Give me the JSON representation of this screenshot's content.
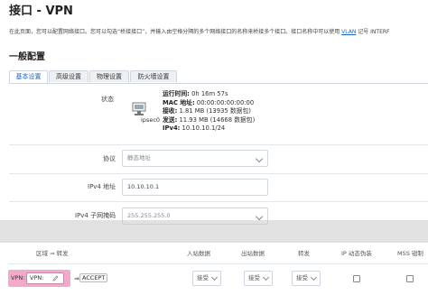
{
  "header": {
    "title": "接口 - VPN",
    "description_prefix": "在此页面，您可以配置网络接口。您可以勾选“桥接接口”，并输入由空格分隔的多个网络接口的名称来桥接多个接口。接口名称中可以使用 ",
    "vlan_link": "VLAN",
    "description_suffix": " 记号 INTERF"
  },
  "section": {
    "title": "一般配置"
  },
  "tabs": [
    {
      "label": "基本设置"
    },
    {
      "label": "高级设置"
    },
    {
      "label": "物理设置"
    },
    {
      "label": "防火墙设置"
    }
  ],
  "status": {
    "label": "状态",
    "interface_name": "ipsec0",
    "icon": "network-interface-icon",
    "lines": [
      {
        "key": "运行时间:",
        "value": " 0h 16m 57s"
      },
      {
        "key": "MAC 地址:",
        "value": " 00:00:00:00:00:00"
      },
      {
        "key": "接收:",
        "value": " 1.81 MB (13935 数据包)"
      },
      {
        "key": "发送:",
        "value": " 11.93 MB (14668 数据包)"
      },
      {
        "key": "IPv4:",
        "value": " 10.10.10.1/24"
      }
    ]
  },
  "form": {
    "protocol": {
      "label": "协议",
      "value": "静态地址"
    },
    "ipv4": {
      "label": "IPv4 地址",
      "value": "10.10.10.1"
    },
    "netmask": {
      "label": "IPv4 子网掩码",
      "value": "255.255.255.0"
    }
  },
  "zone_table": {
    "headers": [
      "区域 ⇒ 转发",
      "入站数据",
      "出站数据",
      "转发",
      "IP 动态伪装",
      "MSS 钳制"
    ],
    "row": {
      "zone_prefix": "VPN:",
      "zone_name": "VPN:",
      "arrow": "⇒",
      "forward_target": "ACCEPT",
      "input": "接受",
      "output": "接受",
      "forward": "接受"
    }
  },
  "colors": {
    "accent": "#1a66c4",
    "zone_vpn": "#f2aaca"
  }
}
